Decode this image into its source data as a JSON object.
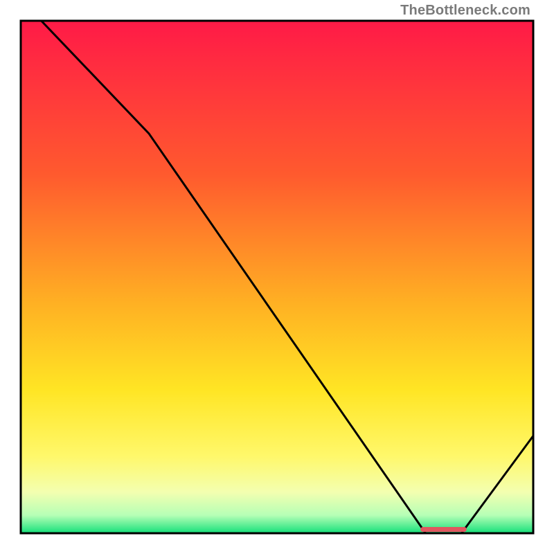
{
  "brand_label": "TheBottleneck.com",
  "chart_data": {
    "type": "line",
    "title": "",
    "xlabel": "",
    "ylabel": "",
    "xlim": [
      0,
      100
    ],
    "ylim": [
      0,
      100
    ],
    "x": [
      4,
      25,
      79,
      86,
      100
    ],
    "values": [
      100,
      78,
      0,
      0,
      19
    ],
    "marker_range_x": [
      78,
      87
    ],
    "gradient_stops": [
      {
        "offset": 0,
        "color": "#ff1a47"
      },
      {
        "offset": 30,
        "color": "#ff5a2e"
      },
      {
        "offset": 55,
        "color": "#ffb023"
      },
      {
        "offset": 72,
        "color": "#ffe524"
      },
      {
        "offset": 85,
        "color": "#fff86b"
      },
      {
        "offset": 92,
        "color": "#f3ffb0"
      },
      {
        "offset": 96.5,
        "color": "#b6ffb6"
      },
      {
        "offset": 100,
        "color": "#14e07a"
      }
    ],
    "curve_color": "#000000",
    "marker_color": "#e0575f",
    "frame_color": "#000000"
  }
}
